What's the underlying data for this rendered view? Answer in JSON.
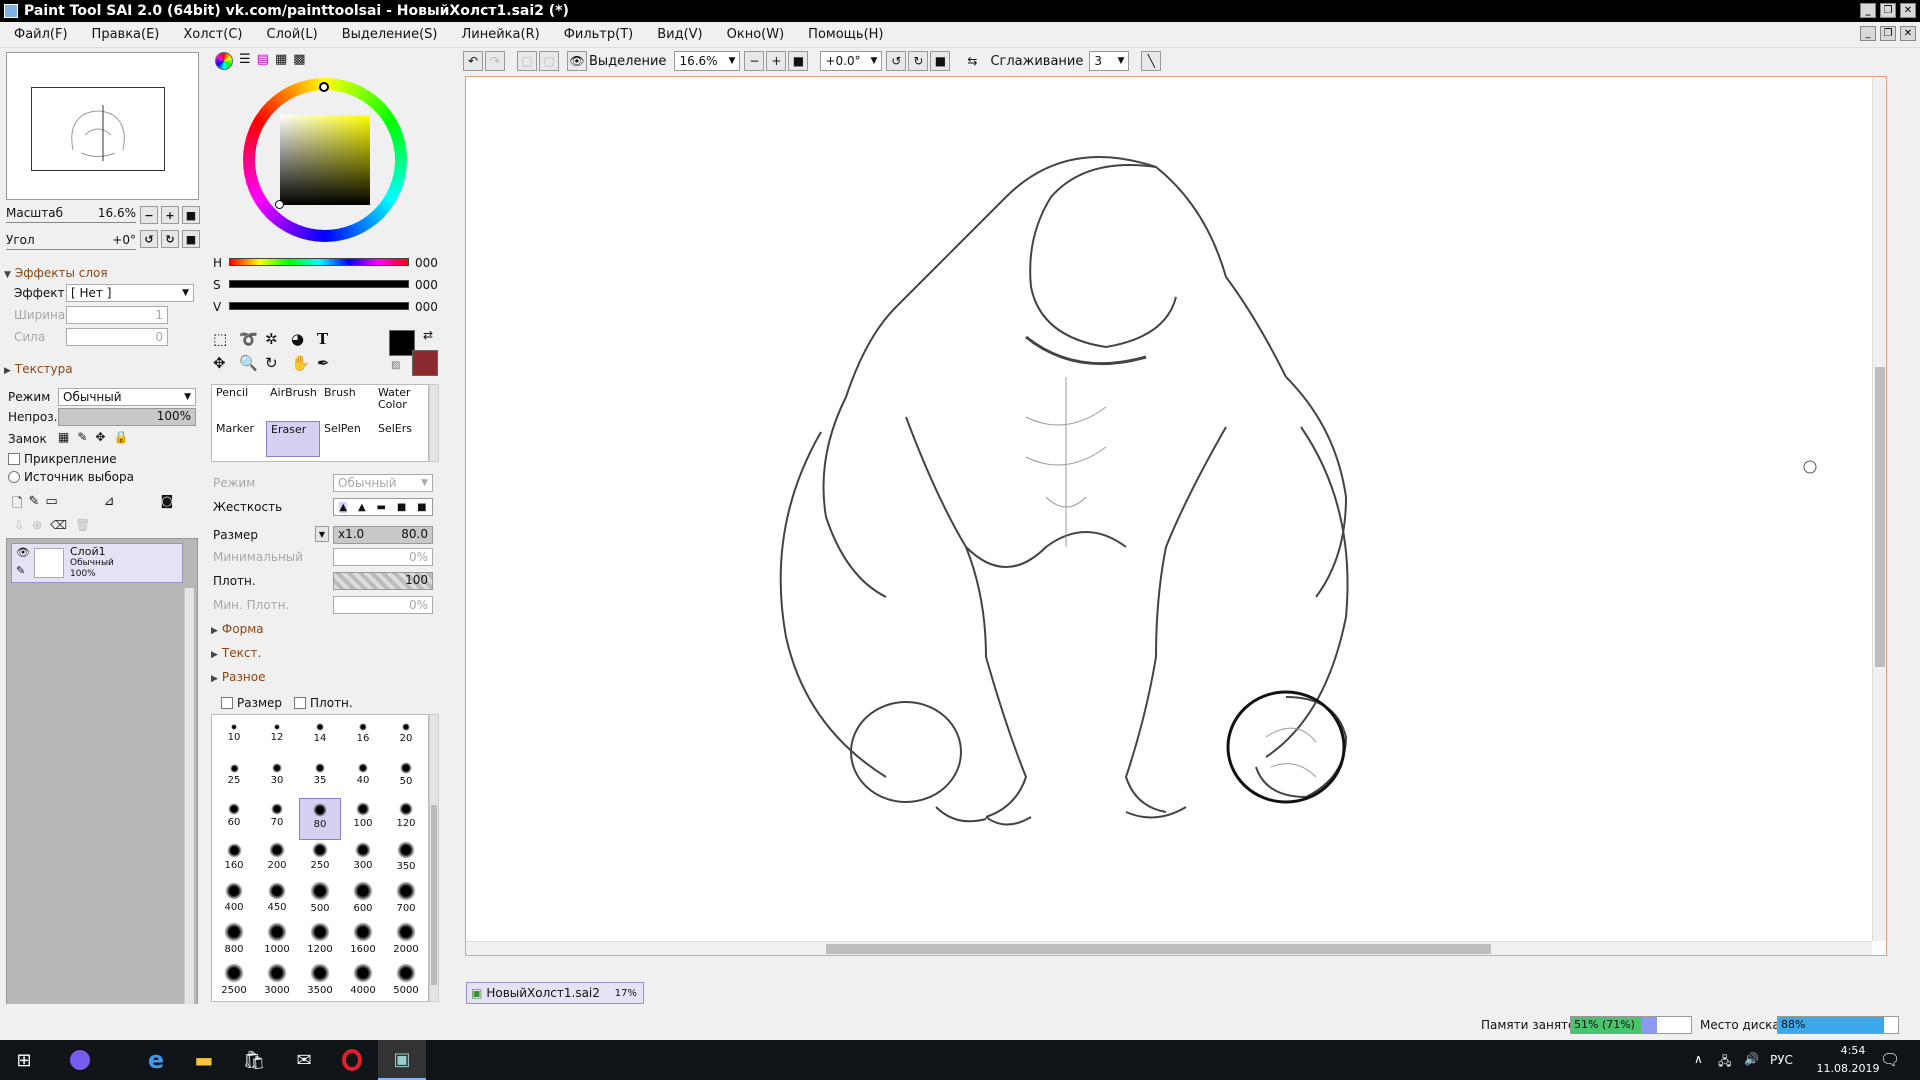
{
  "window": {
    "title": "Paint Tool SAI 2.0 (64bit) vk.com/painttoolsai - НовыйХолст1.sai2 (*)"
  },
  "menu": [
    "Файл(F)",
    "Правка(E)",
    "Холст(C)",
    "Слой(L)",
    "Выделение(S)",
    "Линейка(R)",
    "Фильтр(T)",
    "Вид(V)",
    "Окно(W)",
    "Помощь(H)"
  ],
  "navigator": {
    "zoom_label": "Масштаб",
    "zoom_value": "16.6%",
    "angle_label": "Угол",
    "angle_value": "+0°"
  },
  "layer_effects": {
    "header": "Эффекты слоя",
    "effect_label": "Эффект",
    "effect_value": "[ Нет ]",
    "width_label": "Ширина",
    "width_value": "1",
    "strength_label": "Сила",
    "strength_value": "0",
    "texture_header": "Текстура"
  },
  "layer_props": {
    "mode_label": "Режим",
    "mode_value": "Обычный",
    "opacity_label": "Непроз.",
    "opacity_value": "100%",
    "lock_label": "Замок",
    "clip_label": "Прикрепление",
    "source_label": "Источник выбора"
  },
  "layers": [
    {
      "name": "Слой1",
      "mode": "Обычный",
      "opacity": "100%"
    }
  ],
  "color": {
    "h_label": "H",
    "h_value": "000",
    "s_label": "S",
    "s_value": "000",
    "v_label": "V",
    "v_value": "000",
    "foreground": "#000000",
    "background": "#8b2a2e"
  },
  "tools": [
    {
      "label": "Pencil"
    },
    {
      "label": "AirBrush"
    },
    {
      "label": "Brush"
    },
    {
      "label": "Water Color"
    },
    {
      "label": "Marker"
    },
    {
      "label": "Eraser",
      "selected": true
    },
    {
      "label": "SelPen"
    },
    {
      "label": "SelErs"
    }
  ],
  "tool_settings": {
    "mode_label": "Режим",
    "mode_value": "Обычный",
    "hardness_label": "Жесткость",
    "size_label": "Размер",
    "size_mult": "x1.0",
    "size_value": "80.0",
    "min_label": "Минимальный",
    "min_value": "0%",
    "density_label": "Плотн.",
    "density_value": "100",
    "min_density_label": "Мин. Плотн.",
    "min_density_value": "0%",
    "shape_header": "Форма",
    "text_header": "Текст.",
    "misc_header": "Разное",
    "size_check": "Размер",
    "density_check": "Плотн."
  },
  "brush_sizes": [
    "10",
    "12",
    "14",
    "16",
    "20",
    "25",
    "30",
    "35",
    "40",
    "50",
    "60",
    "70",
    "80",
    "100",
    "120",
    "160",
    "200",
    "250",
    "300",
    "350",
    "400",
    "450",
    "500",
    "600",
    "700",
    "800",
    "1000",
    "1200",
    "1600",
    "2000",
    "2500",
    "3000",
    "3500",
    "4000",
    "5000"
  ],
  "selected_brush_size": "80",
  "canvas_toolbar": {
    "selection_label": "Выделение",
    "zoom": "16.6%",
    "angle": "+0.0°",
    "smoothing_label": "Сглаживание",
    "smoothing_value": "3"
  },
  "document_tab": {
    "name": "НовыйХолст1.sai2",
    "zoom": "17%"
  },
  "status": {
    "memory_label": "Памяти занято",
    "memory_value": "51% (71%)",
    "memory_fraction": 0.51,
    "disk_label": "Место диска",
    "disk_value": "88%",
    "disk_fraction": 0.88
  },
  "taskbar": {
    "lang": "РУС",
    "time": "4:54",
    "date": "11.08.2019"
  }
}
